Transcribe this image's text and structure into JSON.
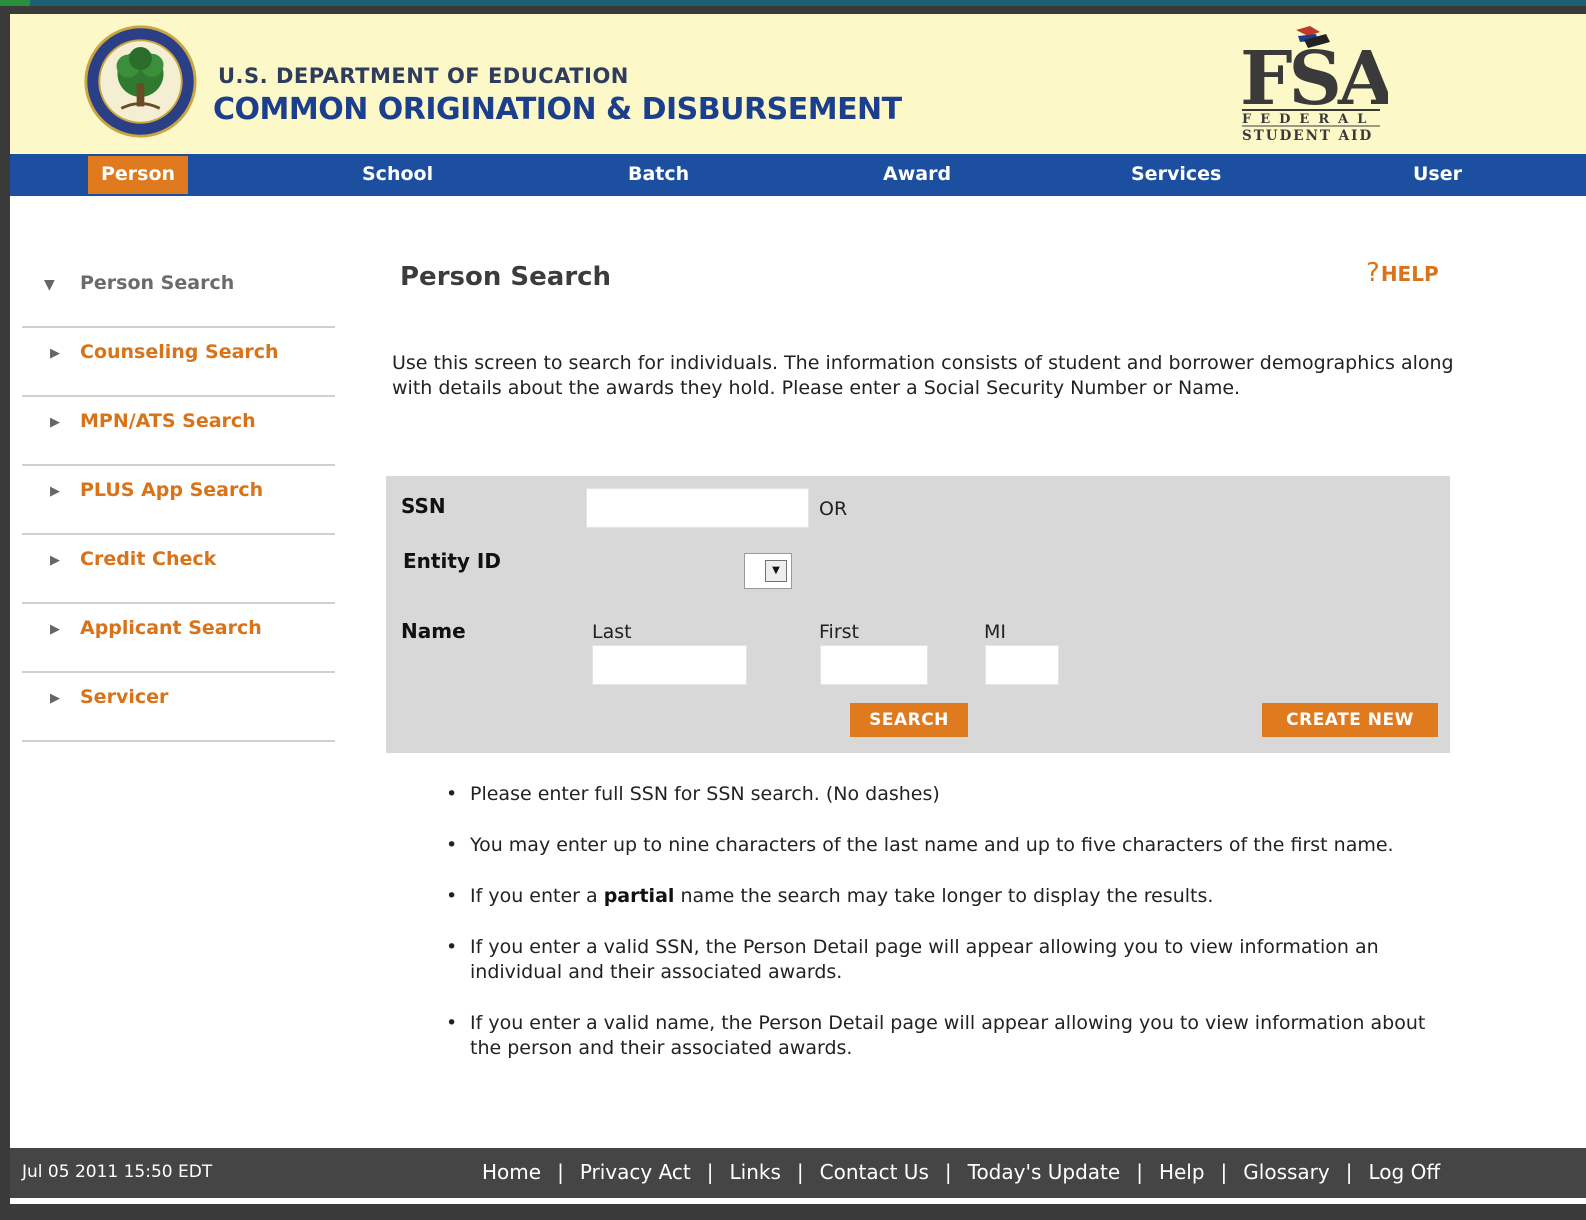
{
  "header": {
    "dept_line": "U.S. DEPARTMENT OF EDUCATION",
    "app_title": "COMMON ORIGINATION & DISBURSEMENT",
    "fsa_logo_text": "FSA",
    "fsa_logo_sub1": "FEDERAL",
    "fsa_logo_sub2": "STUDENT AID",
    "seal_name": "department-of-education-seal"
  },
  "topnav": {
    "active": "Person",
    "items": [
      "Person",
      "School",
      "Batch",
      "Award",
      "Services",
      "User"
    ]
  },
  "sidebar": {
    "items": [
      {
        "label": "Person Search",
        "current": true
      },
      {
        "label": "Counseling Search"
      },
      {
        "label": "MPN/ATS Search"
      },
      {
        "label": "PLUS App Search"
      },
      {
        "label": "Credit Check"
      },
      {
        "label": "Applicant Search"
      },
      {
        "label": "Servicer"
      }
    ]
  },
  "main": {
    "title": "Person Search",
    "help_label": "HELP",
    "intro": "Use this screen to search for individuals. The information consists of student and borrower demographics along with details about the awards they hold. Please enter a Social Security Number or Name.",
    "form": {
      "ssn_label": "SSN",
      "ssn_value": "",
      "or_label": "OR",
      "entity_label": "Entity ID",
      "entity_value": "",
      "name_label": "Name",
      "last_label": "Last",
      "first_label": "First",
      "mi_label": "MI",
      "last_value": "",
      "first_value": "",
      "mi_value": "",
      "search_button": "SEARCH",
      "create_button": "CREATE NEW"
    },
    "tips": {
      "tip1": "Please enter full SSN for SSN search. (No dashes)",
      "tip2": "You may enter up to nine characters of the last name and up to five characters of the first name.",
      "tip3_before": "If you enter a ",
      "tip3_bold": "partial",
      "tip3_after": " name the search may take longer to display the results.",
      "tip4": "If you enter a valid SSN, the Person Detail page will appear allowing you to view information an individual and their associated awards.",
      "tip5": "If you enter a valid name, the Person Detail page will appear allowing you to view information about the person and their associated awards."
    }
  },
  "footer": {
    "datetime": "Jul 05 2011 15:50 EDT",
    "links": [
      "Home",
      "Privacy Act",
      "Links",
      "Contact Us",
      "Today's Update",
      "Help",
      "Glossary",
      "Log Off"
    ],
    "separator": "|"
  },
  "colors": {
    "accent_orange": "#e07a1e",
    "nav_blue": "#1c4fa0",
    "header_bg": "#fcf8c8",
    "title_blue": "#1b3f8c",
    "panel_gray": "#d8d8d8",
    "footer_bg": "#454545"
  }
}
